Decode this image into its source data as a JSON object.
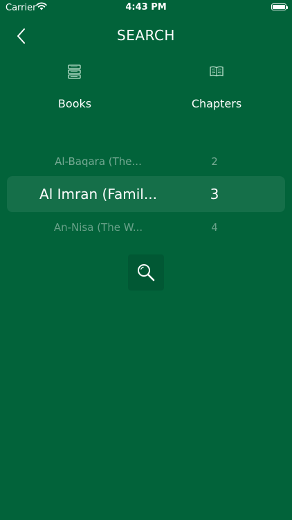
{
  "status": {
    "carrier": "Carrier",
    "time": "4:43 PM"
  },
  "nav": {
    "title": "SEARCH"
  },
  "tabs": {
    "books": "Books",
    "chapters": "Chapters"
  },
  "picker": {
    "books": {
      "prev": "Al-Baqara (The...",
      "current": "Al Imran (Famil...",
      "next": "An-Nisa (The W..."
    },
    "chapters": {
      "prev": "2",
      "current": "3",
      "next": "4"
    }
  },
  "colors": {
    "background": "#02633a",
    "text": "#ffffff"
  }
}
